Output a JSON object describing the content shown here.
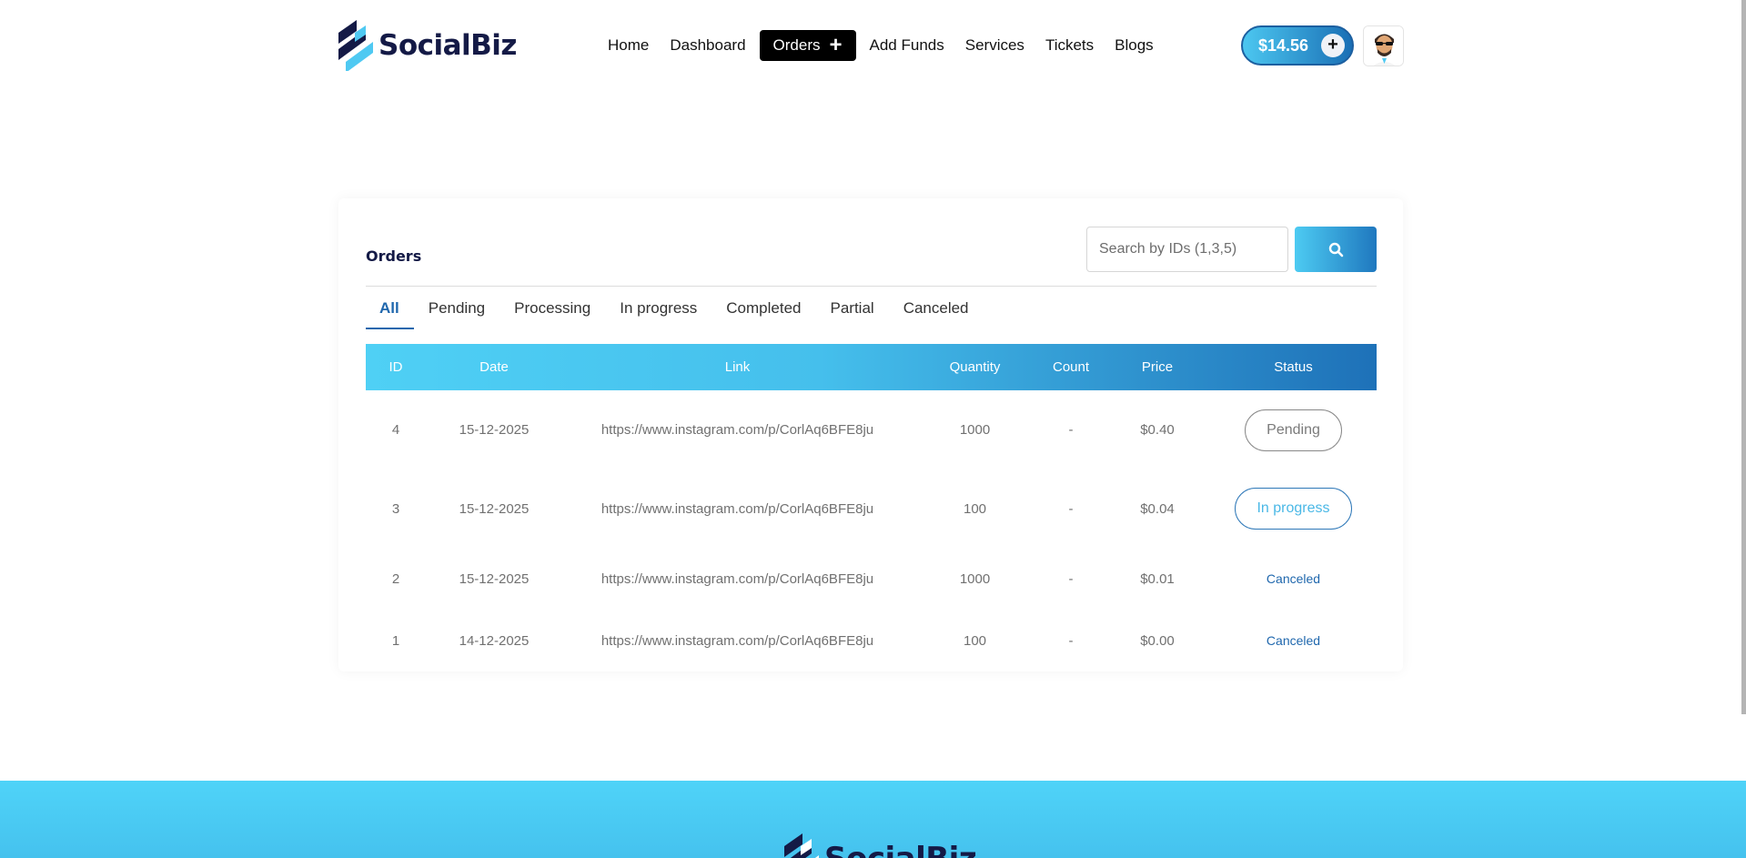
{
  "brand": {
    "name": "SocialBiz"
  },
  "nav": {
    "items": [
      {
        "label": "Home"
      },
      {
        "label": "Dashboard"
      },
      {
        "label": "Orders",
        "active": true
      },
      {
        "label": "Add Funds"
      },
      {
        "label": "Services"
      },
      {
        "label": "Tickets"
      },
      {
        "label": "Blogs"
      }
    ],
    "orders_plus_icon": "plus-icon"
  },
  "account": {
    "balance": "$14.56",
    "add_funds_icon": "plus-icon",
    "avatar": "avatar"
  },
  "orders": {
    "title": "Orders",
    "search": {
      "placeholder": "Search by IDs (1,3,5)",
      "button_icon": "search-icon"
    },
    "tabs": [
      "All",
      "Pending",
      "Processing",
      "In progress",
      "Completed",
      "Partial",
      "Canceled"
    ],
    "active_tab": "All",
    "columns": [
      "ID",
      "Date",
      "Link",
      "Quantity",
      "Count",
      "Price",
      "Status"
    ],
    "rows": [
      {
        "id": "4",
        "date": "15-12-2025",
        "link": "https://www.instagram.com/p/CorlAq6BFE8ju",
        "quantity": "1000",
        "count": "-",
        "price": "$0.40",
        "status": "Pending"
      },
      {
        "id": "3",
        "date": "15-12-2025",
        "link": "https://www.instagram.com/p/CorlAq6BFE8ju",
        "quantity": "100",
        "count": "-",
        "price": "$0.04",
        "status": "In progress"
      },
      {
        "id": "2",
        "date": "15-12-2025",
        "link": "https://www.instagram.com/p/CorlAq6BFE8ju",
        "quantity": "1000",
        "count": "-",
        "price": "$0.01",
        "status": "Canceled"
      },
      {
        "id": "1",
        "date": "14-12-2025",
        "link": "https://www.instagram.com/p/CorlAq6BFE8ju",
        "quantity": "100",
        "count": "-",
        "price": "$0.00",
        "status": "Canceled"
      }
    ]
  },
  "footer": {
    "brand": "SocialBiz"
  },
  "colors": {
    "accent_light": "#4fd0f5",
    "accent_dark": "#1e71b8",
    "brand_navy": "#141a46",
    "link_blue": "#1f67ad"
  }
}
